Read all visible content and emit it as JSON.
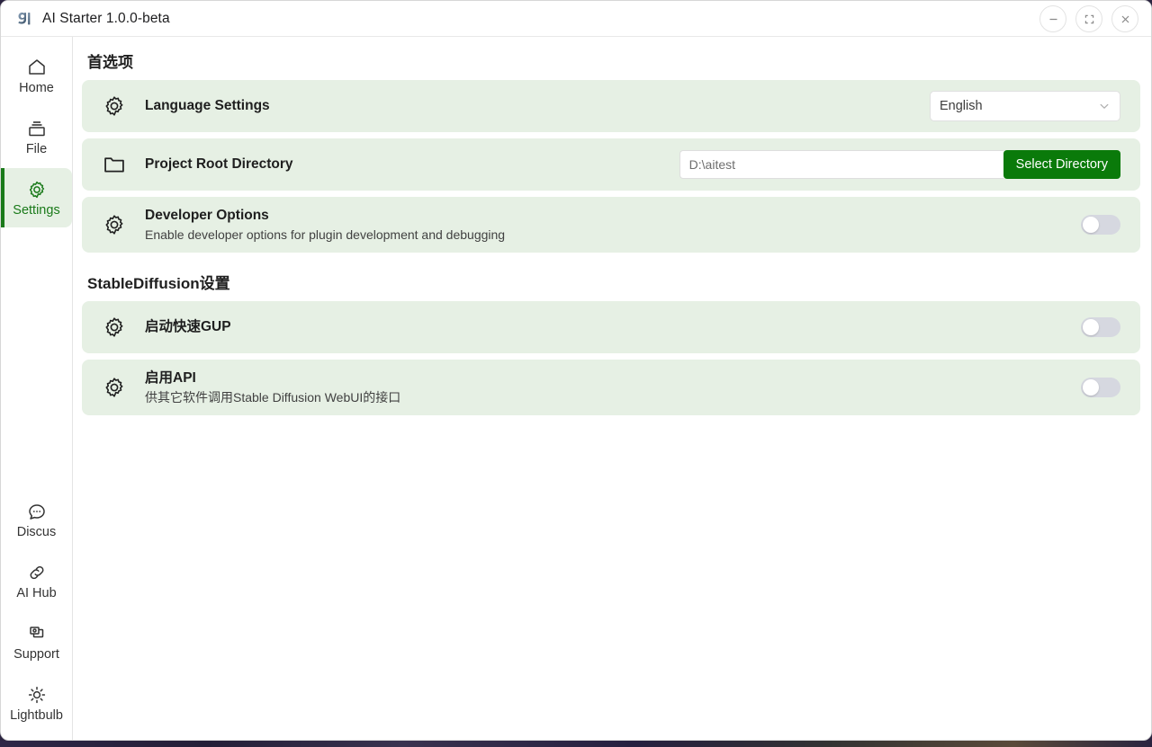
{
  "window": {
    "title": "AI Starter 1.0.0-beta",
    "logo_name": "ai-logo",
    "controls": [
      {
        "name": "minimize-button",
        "label": "Minimize"
      },
      {
        "name": "maximize-button",
        "label": "Maximize"
      },
      {
        "name": "close-button",
        "label": "Close"
      }
    ]
  },
  "colors": {
    "accent_green": "#1a7a1a",
    "button_green": "#0a7a0a",
    "row_background": "#e6f0e4",
    "toggle_off": "#d6d8e0",
    "panel_background": "#ffffff"
  },
  "sidebar": {
    "top_items": [
      {
        "label": "Home",
        "icon": "home-icon",
        "active": false
      },
      {
        "label": "File",
        "icon": "file-stack-icon",
        "active": false
      },
      {
        "label": "Settings",
        "icon": "gear-icon",
        "active": true
      }
    ],
    "bottom_items": [
      {
        "label": "Discus",
        "icon": "chat-bubble-icon",
        "active": false
      },
      {
        "label": "AI Hub",
        "icon": "link-icon",
        "active": false
      },
      {
        "label": "Support",
        "icon": "windows-stack-icon",
        "active": false
      },
      {
        "label": "Lightbulb",
        "icon": "brightness-icon",
        "active": false
      }
    ]
  },
  "main": {
    "sections": [
      {
        "title": "首选项",
        "rows": [
          {
            "icon": "gear-icon",
            "title": "Language Settings",
            "subtitle": "",
            "control": "select",
            "select_value": "English"
          },
          {
            "icon": "folder-icon",
            "title": "Project Root Directory",
            "subtitle": "",
            "control": "path",
            "path_value": "D:\\aitest",
            "path_placeholder": "D:\\aitest",
            "button_label": "Select Directory"
          },
          {
            "icon": "gear-icon",
            "title": "Developer Options",
            "subtitle": "Enable developer options for plugin development and debugging",
            "control": "toggle",
            "toggle_on": false
          }
        ]
      },
      {
        "title": "StableDiffusion设置",
        "rows": [
          {
            "icon": "gear-icon",
            "title": "启动快速GUP",
            "subtitle": "",
            "control": "toggle",
            "toggle_on": false
          },
          {
            "icon": "gear-icon",
            "title": "启用API",
            "subtitle": "供其它软件调用Stable Diffusion WebUI的接口",
            "control": "toggle",
            "toggle_on": false
          }
        ]
      }
    ]
  }
}
